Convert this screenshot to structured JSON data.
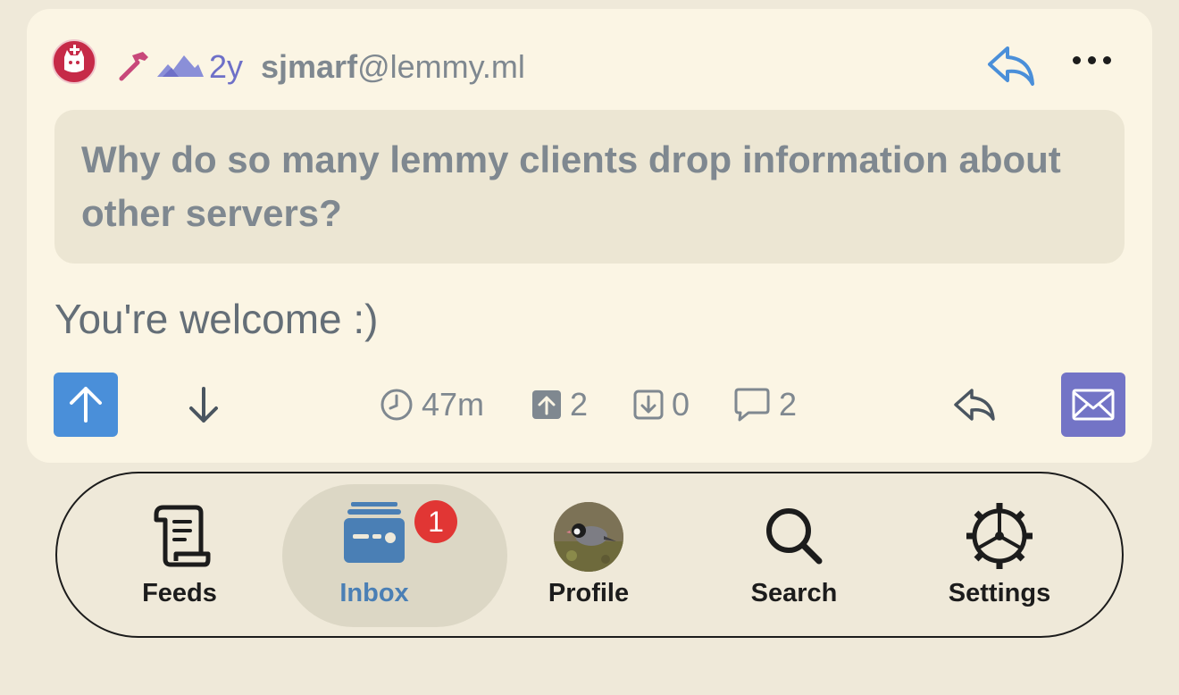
{
  "post": {
    "age": "2y",
    "username": "sjmarf",
    "instance": "@lemmy.ml",
    "quote": "Why do so many lemmy clients drop information about other servers?",
    "body": "You're welcome :)",
    "stats": {
      "time": "47m",
      "upvotes": "2",
      "downvotes": "0",
      "comments": "2"
    }
  },
  "icons": {
    "author_badge": "cat-avatar-icon",
    "dev_badge": "hammer-icon",
    "instance_badge": "mountains-icon",
    "reply": "reply-arrow-icon",
    "more": "ellipsis-icon",
    "upvote": "arrow-up-icon",
    "downvote": "arrow-down-icon",
    "clock": "clock-icon",
    "mail": "envelope-icon"
  },
  "tabbar": {
    "tabs": [
      {
        "label": "Feeds",
        "icon": "scroll-icon"
      },
      {
        "label": "Inbox",
        "icon": "inbox-icon",
        "badge": "1",
        "active": true
      },
      {
        "label": "Profile",
        "icon": "avatar-photo"
      },
      {
        "label": "Search",
        "icon": "search-icon"
      },
      {
        "label": "Settings",
        "icon": "gear-icon"
      }
    ]
  },
  "colors": {
    "background": "#efe9d9",
    "card": "#fbf5e4",
    "upvote_blue": "#4a8fd9",
    "mail_purple": "#7374c6",
    "age_purple": "#6e70c8",
    "badge_red": "#e13634",
    "active_tab_text": "#4a7fb5"
  }
}
